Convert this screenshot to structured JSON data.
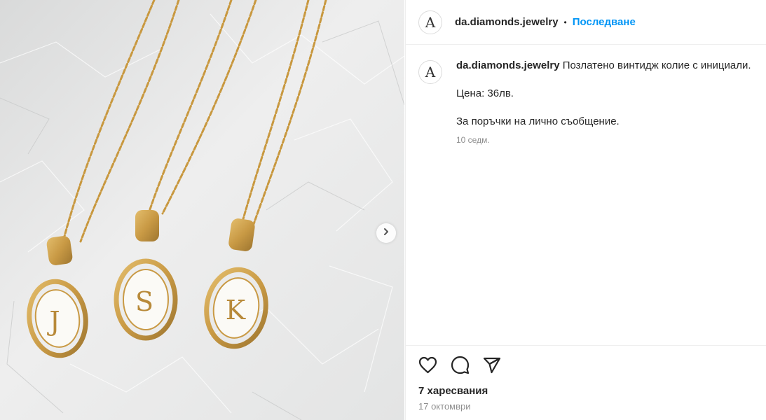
{
  "post": {
    "username": "da.diamonds.jewelry",
    "separator": "•",
    "follow_label": "Последване",
    "avatar_glyph": "A",
    "caption": {
      "username": "da.diamonds.jewelry",
      "text": "Позлатено винтидж колие с инициали.",
      "price": "Цена: 36лв.",
      "order_note": "За поръчки на лично съобщение.",
      "time_ago": "10 седм."
    },
    "likes": "7 харесвания",
    "date": "17 октомври"
  },
  "image": {
    "pendant_letters": [
      "J",
      "S",
      "K"
    ],
    "colors": {
      "gold": "#c99a45",
      "enamel": "#fbfaf6",
      "paper": "#e6e7e7"
    }
  },
  "icons": {
    "like": "heart-icon",
    "comment": "comment-icon",
    "share": "paper-plane-icon",
    "next": "chevron-right-icon"
  },
  "colors": {
    "accent": "#0095f6",
    "text": "#262626",
    "muted": "#8e8e8e",
    "border": "#efefef"
  }
}
